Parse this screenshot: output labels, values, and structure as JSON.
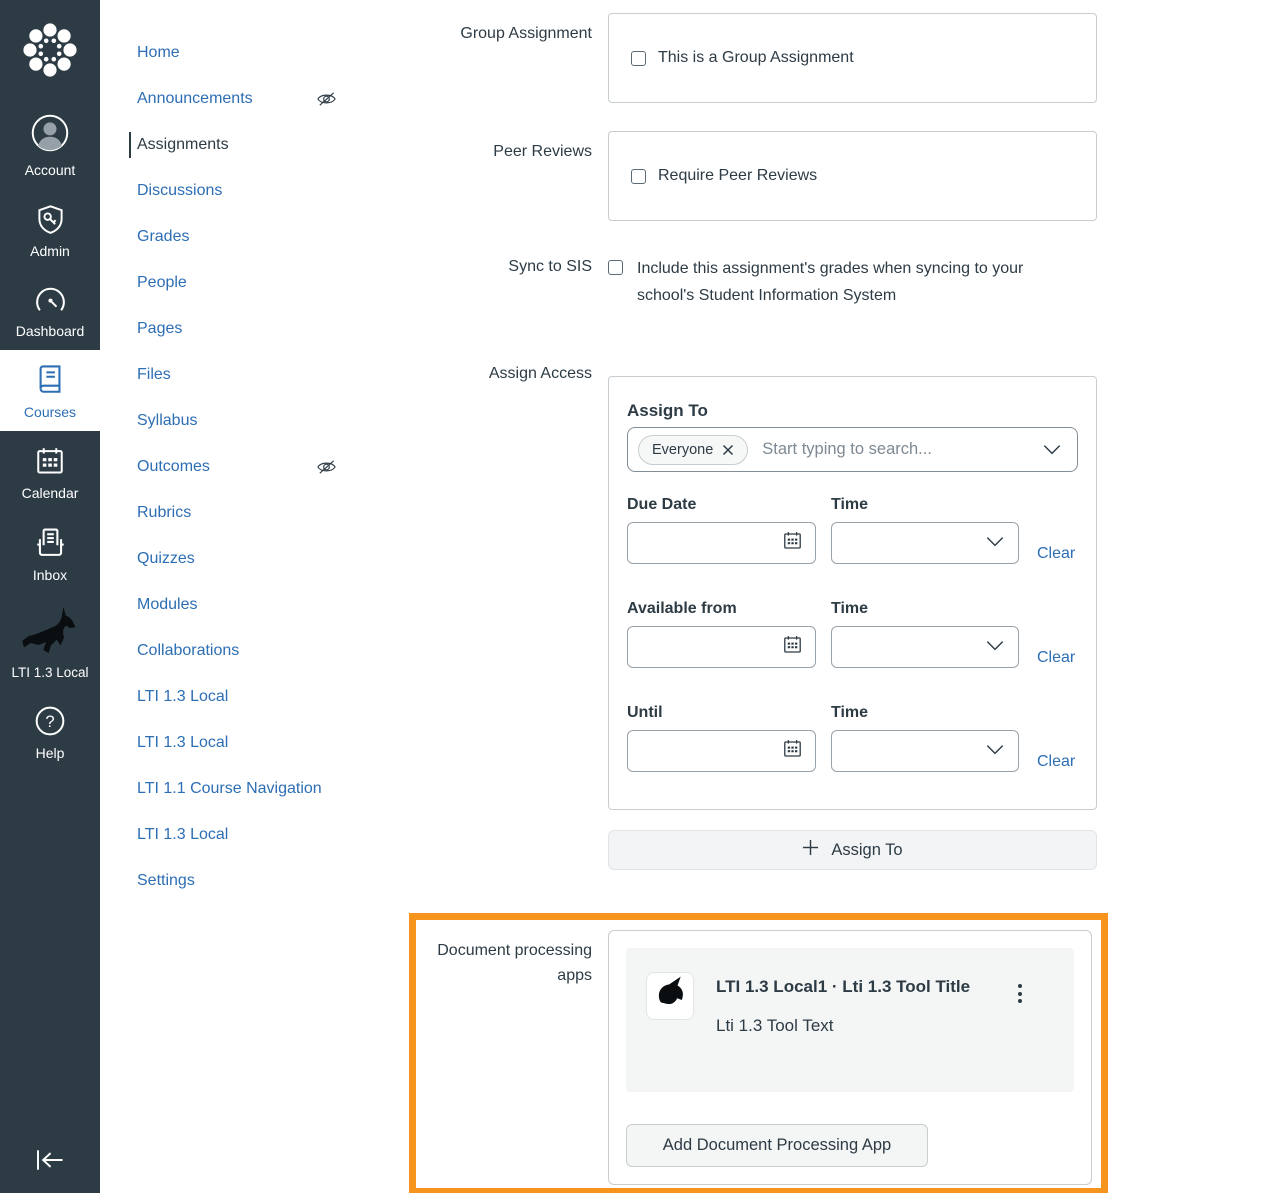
{
  "colors": {
    "sidebar_bg": "#2D3B45",
    "link_blue": "#2D6EB4",
    "text_dark": "#2D3B45",
    "border_gray": "#C7CDD1",
    "highlight_orange": "#F7941D",
    "panel_gray": "#F4F5F5"
  },
  "sidebar": {
    "items": [
      {
        "icon": "canvas-logo-icon",
        "label": ""
      },
      {
        "icon": "account-icon",
        "label": "Account"
      },
      {
        "icon": "admin-icon",
        "label": "Admin"
      },
      {
        "icon": "dashboard-icon",
        "label": "Dashboard"
      },
      {
        "icon": "courses-icon",
        "label": "Courses",
        "active": true
      },
      {
        "icon": "calendar-icon",
        "label": "Calendar"
      },
      {
        "icon": "inbox-icon",
        "label": "Inbox"
      },
      {
        "icon": "unicorn-icon",
        "label": "LTI 1.3 Local"
      },
      {
        "icon": "help-icon",
        "label": "Help"
      }
    ]
  },
  "nav": {
    "items": [
      {
        "label": "Home"
      },
      {
        "label": "Announcements",
        "hidden": true
      },
      {
        "label": "Assignments",
        "active": true
      },
      {
        "label": "Discussions"
      },
      {
        "label": "Grades"
      },
      {
        "label": "People"
      },
      {
        "label": "Pages"
      },
      {
        "label": "Files"
      },
      {
        "label": "Syllabus"
      },
      {
        "label": "Outcomes",
        "hidden": true
      },
      {
        "label": "Rubrics"
      },
      {
        "label": "Quizzes"
      },
      {
        "label": "Modules"
      },
      {
        "label": "Collaborations"
      },
      {
        "label": "LTI 1.3 Local"
      },
      {
        "label": "LTI 1.3 Local"
      },
      {
        "label": "LTI 1.1 Course Navigation"
      },
      {
        "label": "LTI 1.3 Local"
      },
      {
        "label": "Settings"
      }
    ]
  },
  "form": {
    "group_assignment": {
      "label": "Group Assignment",
      "checkbox_label": "This is a Group Assignment",
      "checked": false
    },
    "peer_reviews": {
      "label": "Peer Reviews",
      "checkbox_label": "Require Peer Reviews",
      "checked": false
    },
    "sync_to_sis": {
      "label": "Sync to SIS",
      "checkbox_label": "Include this assignment's grades when syncing to your school's Student Information System",
      "checked": false
    },
    "assign_access": {
      "label": "Assign Access",
      "heading": "Assign To",
      "selected_tag": "Everyone",
      "search_placeholder": "Start typing to search...",
      "rows": [
        {
          "date_label": "Due Date",
          "date_value": "",
          "time_label": "Time",
          "time_value": "",
          "clear_label": "Clear"
        },
        {
          "date_label": "Available from",
          "date_value": "",
          "time_label": "Time",
          "time_value": "",
          "clear_label": "Clear"
        },
        {
          "date_label": "Until",
          "date_value": "",
          "time_label": "Time",
          "time_value": "",
          "clear_label": "Clear"
        }
      ]
    },
    "assign_to_button": "Assign To",
    "document_processing": {
      "label": "Document processing apps",
      "app_title": "LTI 1.3 Local1 · Lti 1.3 Tool Title",
      "app_description": "Lti 1.3 Tool Text",
      "add_button": "Add Document Processing App"
    }
  }
}
